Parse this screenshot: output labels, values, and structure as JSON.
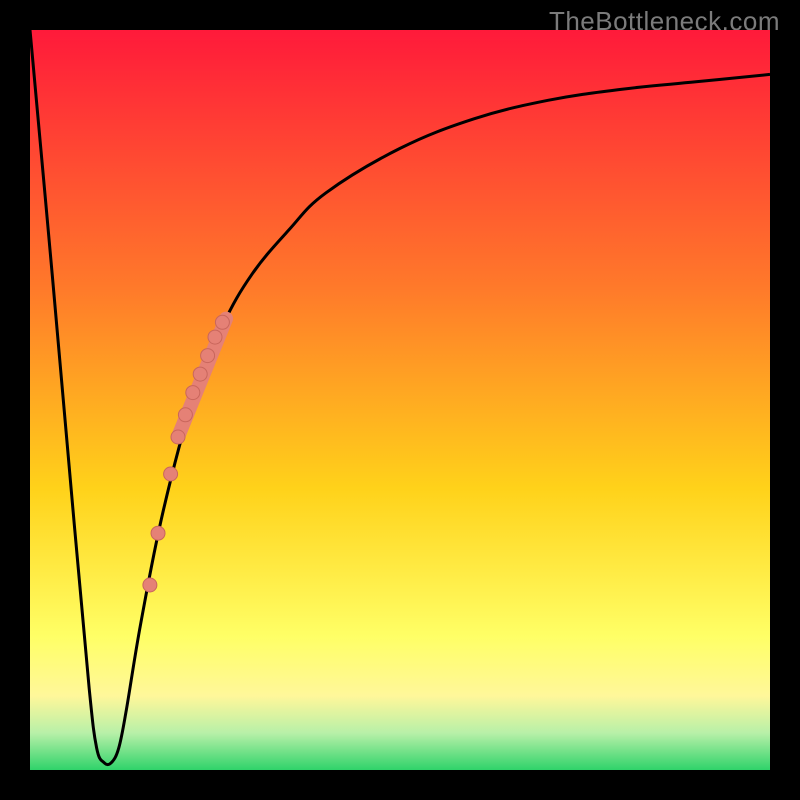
{
  "watermark": "TheBottleneck.com",
  "colors": {
    "top": "#ff1a3a",
    "midUpper": "#ff7a2a",
    "mid": "#ffd21a",
    "midLower": "#ffff66",
    "pale": "#fff79a",
    "greenPale": "#b8f0a8",
    "green": "#2fd36a",
    "curve": "#000000",
    "marker": "#e58176",
    "markerStroke": "#c9665c"
  },
  "chart_data": {
    "type": "line",
    "title": "",
    "xlabel": "",
    "ylabel": "",
    "xlim": [
      0,
      100
    ],
    "ylim": [
      0,
      100
    ],
    "grid": false,
    "legend": false,
    "series": [
      {
        "name": "bottleneck-curve",
        "x": [
          0,
          3,
          6,
          8,
          9,
          10,
          11,
          12,
          13,
          15,
          18,
          22,
          26,
          30,
          35,
          40,
          50,
          60,
          70,
          80,
          90,
          100
        ],
        "y": [
          100,
          67,
          33,
          11,
          3,
          1,
          1,
          3,
          8,
          20,
          35,
          50,
          60,
          67,
          73,
          78,
          84,
          88,
          90.5,
          92,
          93,
          94
        ]
      }
    ],
    "markers": {
      "name": "highlighted-points",
      "x": [
        16.2,
        17.3,
        19.0,
        20.0,
        21.0,
        22.0,
        23.0,
        24.0,
        25.0,
        26.0
      ],
      "y": [
        25,
        32,
        40,
        45,
        48,
        51,
        53.5,
        56,
        58.5,
        60.5
      ]
    },
    "thick_segment": {
      "x": [
        20.0,
        26.5
      ],
      "y": [
        45,
        61
      ]
    }
  }
}
